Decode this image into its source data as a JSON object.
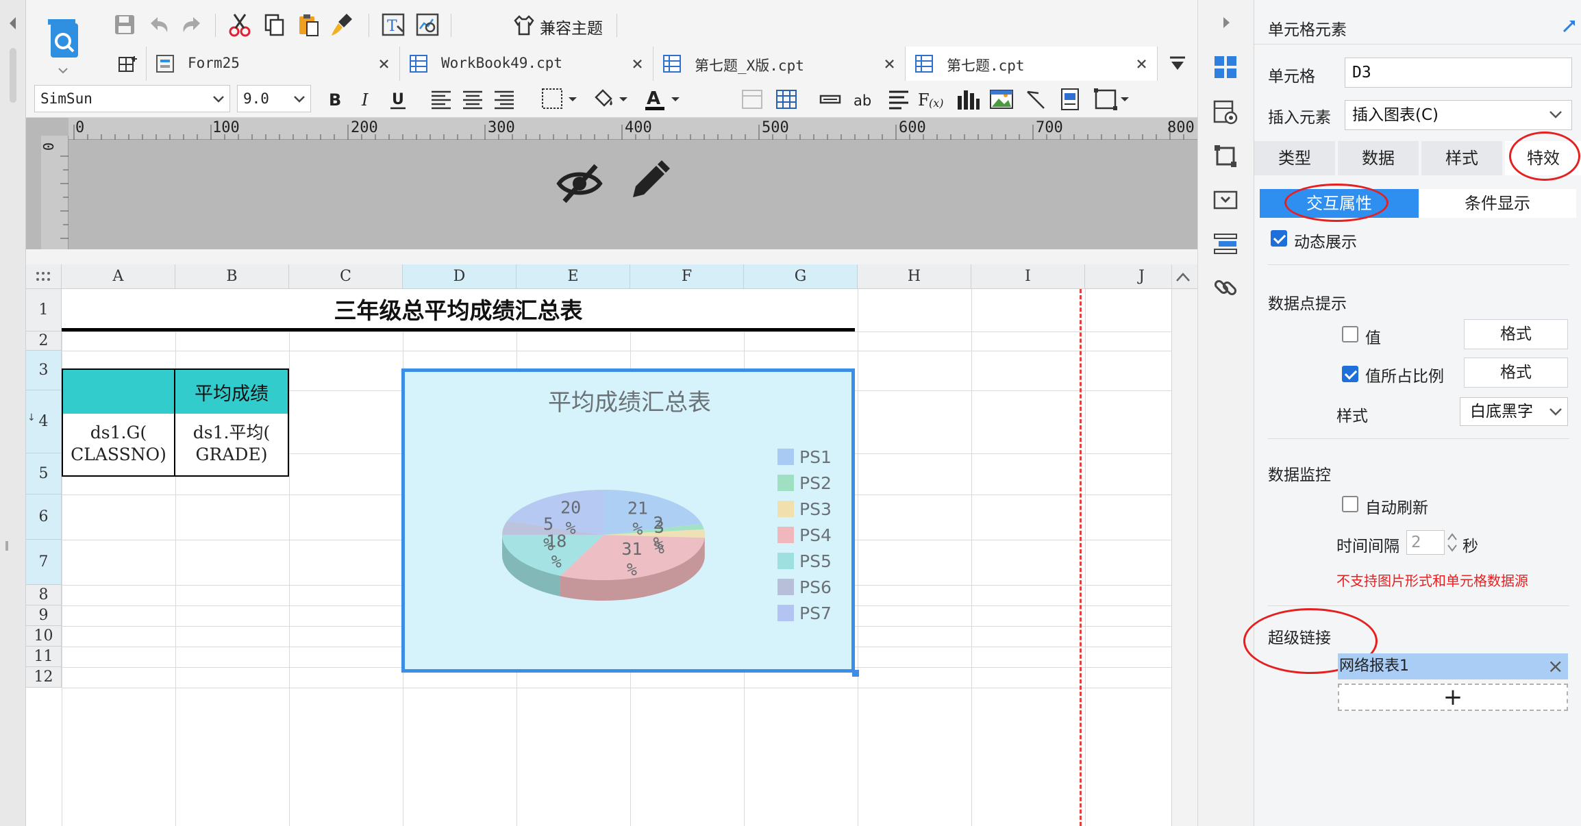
{
  "toolbar": {
    "compat_theme_label": "兼容主题",
    "font_name": "SimSun",
    "font_size": "9.0",
    "tabs": [
      {
        "label": "Form25"
      },
      {
        "label": "WorkBook49.cpt"
      },
      {
        "label": "第七题_X版.cpt"
      },
      {
        "label": "第七题.cpt"
      }
    ],
    "tab_close_glyph": "×"
  },
  "ruler": {
    "labels": [
      "0",
      "100",
      "200",
      "300",
      "400",
      "500",
      "600",
      "700",
      "800"
    ],
    "vlabel": "0"
  },
  "grid": {
    "columns": [
      "A",
      "B",
      "C",
      "D",
      "E",
      "F",
      "G",
      "H",
      "I",
      "J"
    ],
    "rows": [
      "1",
      "2",
      "3",
      "4",
      "5",
      "6",
      "7",
      "8",
      "9",
      "10",
      "11",
      "12"
    ],
    "title": "三年级总平均成绩汇总表",
    "b3": "平均成绩",
    "a4_line1": "ds1.G(",
    "a4_line2": "CLASSNO)",
    "b4_line1": "ds1.平均(",
    "b4_line2": "GRADE)"
  },
  "chart_data": {
    "type": "pie",
    "title": "平均成绩汇总表",
    "series": [
      {
        "name": "PS1",
        "percent": 21,
        "color": "#a9cbf3"
      },
      {
        "name": "PS2",
        "percent": 2,
        "color": "#9fe0c2"
      },
      {
        "name": "PS3",
        "percent": 3,
        "color": "#f1dfae"
      },
      {
        "name": "PS4",
        "percent": 31,
        "color": "#f0b8bc"
      },
      {
        "name": "PS5",
        "percent": 18,
        "color": "#9ee0e0"
      },
      {
        "name": "PS6",
        "percent": 5,
        "color": "#b8bfd8"
      },
      {
        "name": "PS7",
        "percent": 20,
        "color": "#b3c4f2"
      }
    ],
    "legend_position": "right",
    "background": "#d6f3fb"
  },
  "panel": {
    "header": "单元格元素",
    "cell_label": "单元格",
    "cell_value": "D3",
    "insert_label": "插入元素",
    "insert_value": "插入图表(C)",
    "tabs": [
      "类型",
      "数据",
      "样式",
      "特效"
    ],
    "subtabs": [
      "交互属性",
      "条件显示"
    ],
    "dynamic_show": "动态展示",
    "datapoint_tip": "数据点提示",
    "value_label": "值",
    "format_label": "格式",
    "percent_label": "值所占比例",
    "style_label": "样式",
    "style_value": "白底黑字",
    "monitor": "数据监控",
    "auto_refresh": "自动刷新",
    "interval_label": "时间间隔",
    "interval_value": "2",
    "interval_unit": "秒",
    "warning": "不支持图片形式和单元格数据源",
    "hyperlink": "超级链接",
    "link_item": "网络报表1",
    "link_remove": "×",
    "add_glyph": "+"
  },
  "colors": {
    "accent": "#1e6fd9",
    "selection": "#3a8ee6",
    "cyan_header": "#33cccc",
    "warning": "#e52020"
  }
}
